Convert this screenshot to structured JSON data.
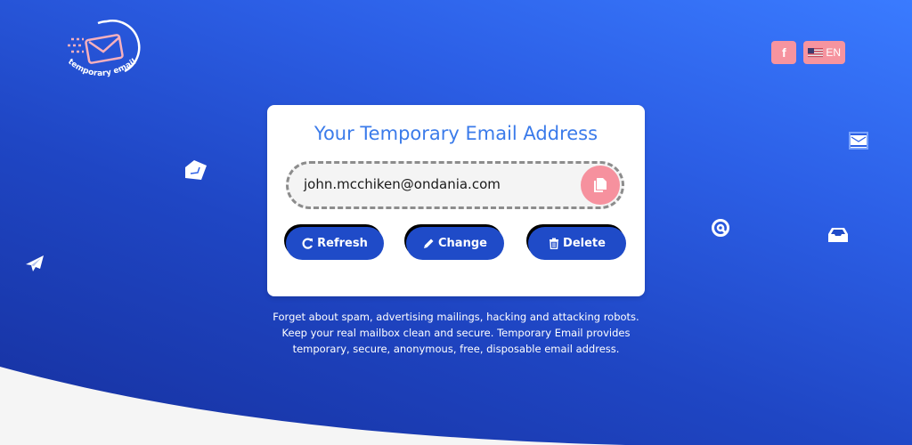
{
  "brand": {
    "logo_text": "temporary email",
    "logo_icon": "envelope-speed-icon"
  },
  "header": {
    "facebook_label": "f",
    "facebook_icon": "facebook-icon",
    "language_label": "EN",
    "language_flag": "us-flag-icon"
  },
  "card": {
    "title": "Your Temporary Email Address",
    "email_value": "john.mcchiken@ondania.com",
    "copy_icon": "copy-icon",
    "buttons": [
      {
        "label": "Refresh",
        "icon": "refresh-icon"
      },
      {
        "label": "Change",
        "icon": "pencil-icon"
      },
      {
        "label": "Delete",
        "icon": "trash-icon"
      }
    ]
  },
  "description": {
    "lines": [
      "Forget about spam, advertising mailings, hacking and attacking robots.",
      "Keep your real mailbox clean and secure. Temporary Email provides",
      "temporary, secure, anonymous, free, disposable email address."
    ]
  },
  "decorations": [
    "open-envelope-icon",
    "envelope-icon",
    "at-sign-icon",
    "inbox-icon",
    "paper-plane-icon"
  ],
  "colors": {
    "accent_pink": "#f6949f",
    "title_blue": "#3b7bea",
    "button_blue": "#1f4bc8",
    "background_top": "#3a7bff",
    "background_bottom": "#16309e"
  }
}
